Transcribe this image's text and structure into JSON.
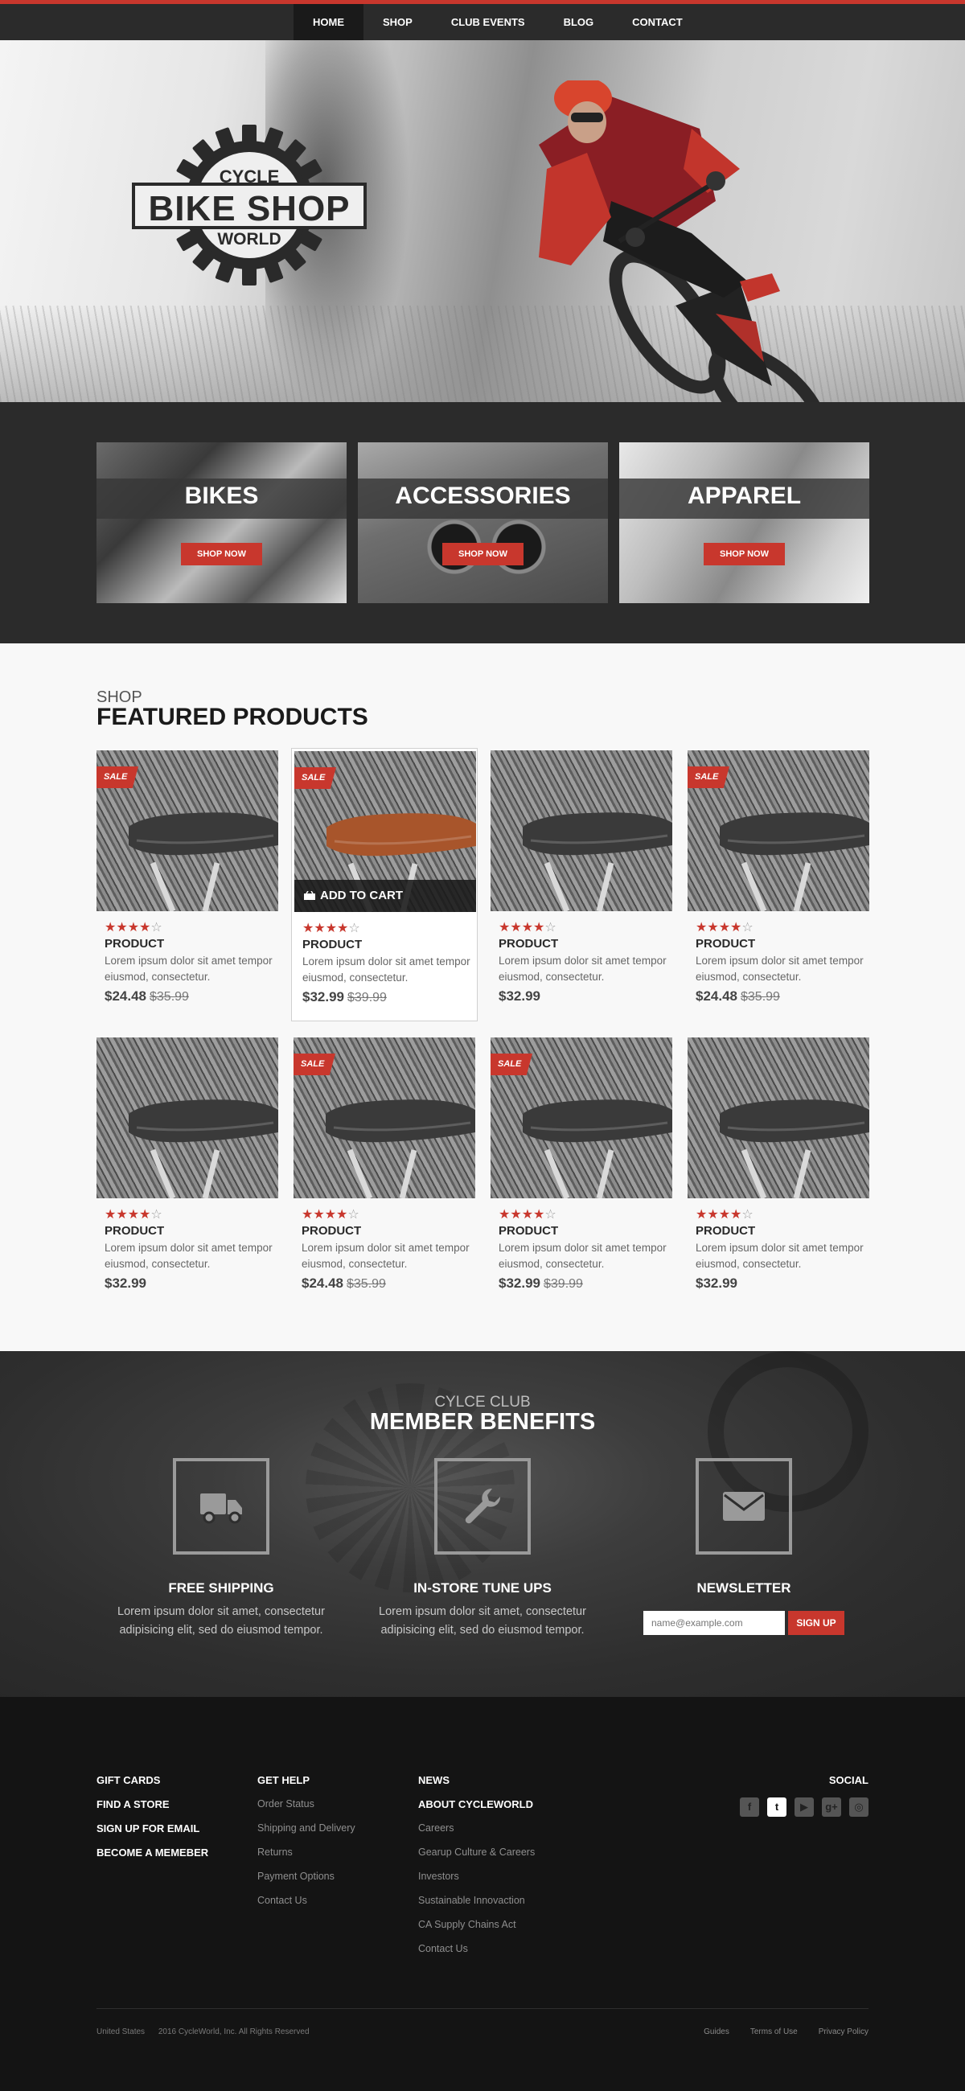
{
  "nav": {
    "items": [
      {
        "label": "HOME",
        "active": true
      },
      {
        "label": "SHOP",
        "active": false
      },
      {
        "label": "CLUB EVENTS",
        "active": false
      },
      {
        "label": "BLOG",
        "active": false
      },
      {
        "label": "CONTACT",
        "active": false
      }
    ]
  },
  "hero": {
    "logo_line1": "CYCLE",
    "logo_line2": "BIKE SHOP",
    "logo_line3": "WORLD"
  },
  "categories": [
    {
      "title": "BIKES",
      "button": "SHOP NOW"
    },
    {
      "title": "ACCESSORIES",
      "button": "SHOP NOW"
    },
    {
      "title": "APPAREL",
      "button": "SHOP NOW"
    }
  ],
  "featured": {
    "kicker": "SHOP",
    "title": "FEATURED PRODUCTS",
    "sale_badge": "SALE",
    "add_to_cart": "ADD TO CART",
    "products": [
      {
        "name": "PRODUCT",
        "desc": "Lorem ipsum dolor sit amet tempor eiusmod, consectetur.",
        "price": "$24.48",
        "old_price": "$35.99",
        "sale": true,
        "rating": 4,
        "highlighted": false
      },
      {
        "name": "PRODUCT",
        "desc": "Lorem ipsum dolor sit amet tempor eiusmod, consectetur.",
        "price": "$32.99",
        "old_price": "$39.99",
        "sale": true,
        "rating": 4,
        "highlighted": true
      },
      {
        "name": "PRODUCT",
        "desc": "Lorem ipsum dolor sit amet tempor eiusmod, consectetur.",
        "price": "$32.99",
        "old_price": "",
        "sale": false,
        "rating": 4,
        "highlighted": false
      },
      {
        "name": "PRODUCT",
        "desc": "Lorem ipsum dolor sit amet tempor eiusmod, consectetur.",
        "price": "$24.48",
        "old_price": "$35.99",
        "sale": true,
        "rating": 4,
        "highlighted": false
      },
      {
        "name": "PRODUCT",
        "desc": "Lorem ipsum dolor sit amet tempor eiusmod, consectetur.",
        "price": "$32.99",
        "old_price": "",
        "sale": false,
        "rating": 4,
        "highlighted": false
      },
      {
        "name": "PRODUCT",
        "desc": "Lorem ipsum dolor sit amet tempor eiusmod, consectetur.",
        "price": "$24.48",
        "old_price": "$35.99",
        "sale": true,
        "rating": 4,
        "highlighted": false
      },
      {
        "name": "PRODUCT",
        "desc": "Lorem ipsum dolor sit amet tempor eiusmod, consectetur.",
        "price": "$32.99",
        "old_price": "$39.99",
        "sale": true,
        "rating": 4,
        "highlighted": false
      },
      {
        "name": "PRODUCT",
        "desc": "Lorem ipsum dolor sit amet tempor eiusmod, consectetur.",
        "price": "$32.99",
        "old_price": "",
        "sale": false,
        "rating": 4,
        "highlighted": false
      }
    ]
  },
  "benefits": {
    "kicker": "CYLCE CLUB",
    "title": "MEMBER BENEFITS",
    "items": [
      {
        "title": "FREE SHIPPING",
        "desc": "Lorem ipsum dolor sit amet, consectetur adipisicing elit, sed do eiusmod tempor.",
        "icon": "truck-icon"
      },
      {
        "title": "IN-STORE TUNE UPS",
        "desc": "Lorem ipsum dolor sit amet, consectetur adipisicing elit, sed do eiusmod tempor.",
        "icon": "wrench-icon"
      },
      {
        "title": "NEWSLETTER",
        "desc": "",
        "icon": "envelope-icon"
      }
    ],
    "newsletter_placeholder": "name@example.com",
    "newsletter_button": "SIGN UP"
  },
  "footer": {
    "col1": [
      "GIFT CARDS",
      "FIND A STORE",
      "SIGN UP FOR EMAIL",
      "BECOME A MEMEBER"
    ],
    "col2_title": "GET HELP",
    "col2": [
      "Order Status",
      "Shipping and Delivery",
      "Returns",
      "Payment Options",
      "Contact Us"
    ],
    "col3_titles": [
      "NEWS",
      "ABOUT CYCLEWORLD"
    ],
    "col3": [
      "Careers",
      "Gearup Culture & Careers",
      "Investors",
      "Sustainable Innovaction",
      "CA Supply Chains Act",
      "Contact Us"
    ],
    "social_title": "SOCIAL",
    "socials": [
      {
        "glyph": "f",
        "icon": "facebook-icon",
        "active": false
      },
      {
        "glyph": "t",
        "icon": "twitter-icon",
        "active": true
      },
      {
        "glyph": "▶",
        "icon": "youtube-icon",
        "active": false
      },
      {
        "glyph": "g+",
        "icon": "google-plus-icon",
        "active": false
      },
      {
        "glyph": "◎",
        "icon": "instagram-icon",
        "active": false
      }
    ],
    "country": "United States",
    "copyright": "2016 CycleWorld, Inc. All Rights Reserved",
    "links": [
      "Guides",
      "Terms of Use",
      "Privacy Policy"
    ]
  },
  "colors": {
    "accent": "#c8372d",
    "dark": "#2b2b2b",
    "footer": "#141414"
  }
}
